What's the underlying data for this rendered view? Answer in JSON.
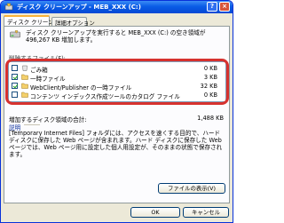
{
  "window": {
    "title": "ディスク クリーンアップ - MEB_XXX (C:)"
  },
  "tabs": [
    {
      "label": "ディスク クリーンアップ",
      "active": true
    },
    {
      "label": "詳細オプション",
      "active": false
    }
  ],
  "description": {
    "line1": "ディスク クリーンアップを実行すると MEB_XXX (C:) の空き領域が",
    "line2": "496,267 KB 増加します。"
  },
  "files_section_label": "削除するファイル(F):",
  "file_list": [
    {
      "label": "ごみ箱",
      "size": "0 KB",
      "checked": false,
      "icon": "recycle-bin-icon"
    },
    {
      "label": "一時ファイル",
      "size": "3 KB",
      "checked": true,
      "icon": "folder-icon"
    },
    {
      "label": "WebClient/Publisher の一時ファイル",
      "size": "32 KB",
      "checked": true,
      "icon": "folder-icon"
    },
    {
      "label": "コンテンツ インデックス作成ツールのカタログ ファイル",
      "size": "0 KB",
      "checked": false,
      "icon": "folder-icon"
    }
  ],
  "total": {
    "label": "増加するディスク領域の合計:",
    "value": "1,488 KB"
  },
  "explanation": {
    "title": "説明",
    "body": "[Temporary Internet Files] フォルダには、アクセスを速くする目的で、ハード ディスクに保存した Web ページが含まれます。ハード ディスクに保存した Web ページでは、Web ページ用に設定した個人用設定が、そのままの状態で保存されます。"
  },
  "buttons": {
    "view_files": "ファイルの表示(V)",
    "ok": "OK",
    "cancel": "キャンセル"
  }
}
